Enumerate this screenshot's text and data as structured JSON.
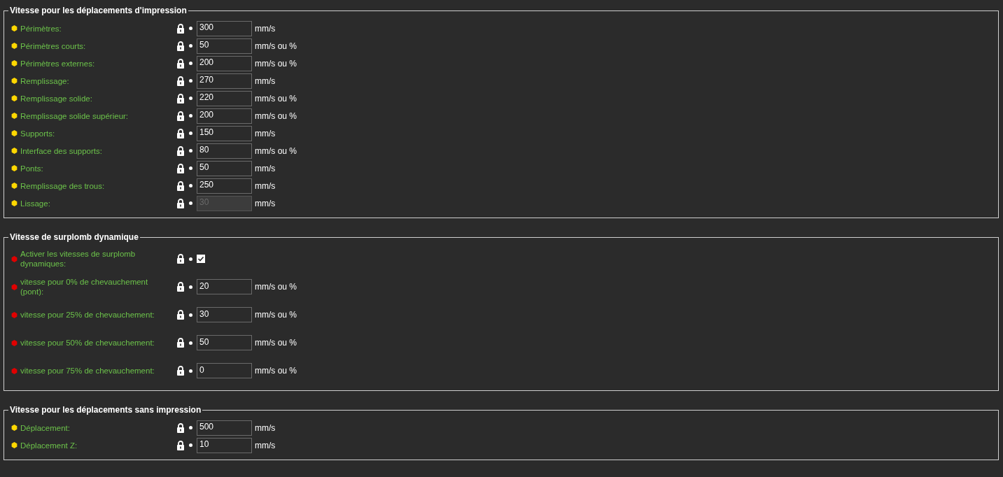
{
  "groups": [
    {
      "title": "Vitesse pour les déplacements d'impression",
      "tall": false,
      "rows": [
        {
          "kind": "number",
          "label": "Périmètres:",
          "color": "#ffd700",
          "value": "300",
          "unit": "mm/s",
          "disabled": false
        },
        {
          "kind": "number",
          "label": "Périmètres courts:",
          "color": "#ffd700",
          "value": "50",
          "unit": "mm/s ou %",
          "disabled": false
        },
        {
          "kind": "number",
          "label": "Périmètres externes:",
          "color": "#ffd700",
          "value": "200",
          "unit": "mm/s ou %",
          "disabled": false
        },
        {
          "kind": "number",
          "label": "Remplissage:",
          "color": "#ffd700",
          "value": "270",
          "unit": "mm/s",
          "disabled": false
        },
        {
          "kind": "number",
          "label": "Remplissage solide:",
          "color": "#ffd700",
          "value": "220",
          "unit": "mm/s ou %",
          "disabled": false
        },
        {
          "kind": "number",
          "label": "Remplissage solide supérieur:",
          "color": "#ffd700",
          "value": "200",
          "unit": "mm/s ou %",
          "disabled": false
        },
        {
          "kind": "number",
          "label": "Supports:",
          "color": "#ffd700",
          "value": "150",
          "unit": "mm/s",
          "disabled": false
        },
        {
          "kind": "number",
          "label": "Interface des supports:",
          "color": "#ffd700",
          "value": "80",
          "unit": "mm/s ou %",
          "disabled": false
        },
        {
          "kind": "number",
          "label": "Ponts:",
          "color": "#ffd700",
          "value": "50",
          "unit": "mm/s",
          "disabled": false
        },
        {
          "kind": "number",
          "label": "Remplissage des trous:",
          "color": "#ffd700",
          "value": "250",
          "unit": "mm/s",
          "disabled": false
        },
        {
          "kind": "number",
          "label": "Lissage:",
          "color": "#ffd700",
          "value": "30",
          "unit": "mm/s",
          "disabled": true
        }
      ]
    },
    {
      "title": "Vitesse de surplomb dynamique",
      "tall": true,
      "rows": [
        {
          "kind": "checkbox",
          "label": "Activer les vitesses de surplomb dynamiques:",
          "color": "#e00000",
          "checked": true
        },
        {
          "kind": "number",
          "label": "vitesse pour 0% de chevauchement (pont):",
          "color": "#e00000",
          "value": "20",
          "unit": "mm/s ou %",
          "disabled": false
        },
        {
          "kind": "number",
          "label": "vitesse pour 25% de chevauchement:",
          "color": "#e00000",
          "value": "30",
          "unit": "mm/s ou %",
          "disabled": false
        },
        {
          "kind": "number",
          "label": "vitesse pour 50% de chevauchement:",
          "color": "#e00000",
          "value": "50",
          "unit": "mm/s ou %",
          "disabled": false
        },
        {
          "kind": "number",
          "label": "vitesse pour 75% de chevauchement:",
          "color": "#e00000",
          "value": "0",
          "unit": "mm/s ou %",
          "disabled": false
        }
      ]
    },
    {
      "title": "Vitesse pour les déplacements sans impression",
      "tall": false,
      "rows": [
        {
          "kind": "number",
          "label": "Déplacement:",
          "color": "#ffd700",
          "value": "500",
          "unit": "mm/s",
          "disabled": false
        },
        {
          "kind": "number",
          "label": "Déplacement Z:",
          "color": "#ffd700",
          "value": "10",
          "unit": "mm/s",
          "disabled": false
        }
      ]
    }
  ]
}
